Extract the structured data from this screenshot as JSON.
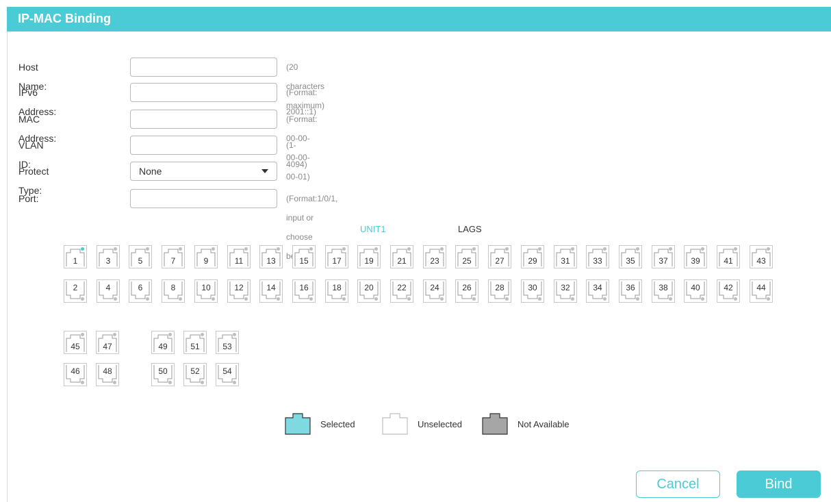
{
  "header": {
    "title": "IP-MAC Binding"
  },
  "form": {
    "host_name": {
      "label": "Host Name:",
      "value": "",
      "hint": "(20 characters maximum)"
    },
    "ipv6": {
      "label": "IPv6 Address:",
      "value": "",
      "hint": "(Format: 2001::1)"
    },
    "mac": {
      "label": "MAC Address:",
      "value": "",
      "hint": "(Format: 00-00-00-00-00-01)"
    },
    "vlan": {
      "label": "VLAN ID:",
      "value": "",
      "hint": "(1-4094)"
    },
    "protect_type": {
      "label": "Protect Type:",
      "selected": "None"
    },
    "port": {
      "label": "Port:",
      "value": "",
      "hint": "(Format:1/0/1, input or choose below)"
    }
  },
  "tabs": {
    "unit1": "UNIT1",
    "lags": "LAGS",
    "active_color": "#4acbd6"
  },
  "ports": {
    "row1": [
      "1",
      "3",
      "5",
      "7",
      "9",
      "11",
      "13",
      "15",
      "17",
      "19",
      "21",
      "23",
      "25",
      "27",
      "29",
      "31",
      "33",
      "35",
      "37",
      "39",
      "41",
      "43"
    ],
    "row2": [
      "2",
      "4",
      "6",
      "8",
      "10",
      "12",
      "14",
      "16",
      "18",
      "20",
      "22",
      "24",
      "26",
      "28",
      "30",
      "32",
      "34",
      "36",
      "38",
      "40",
      "42",
      "44"
    ],
    "group1_top": [
      "45",
      "47"
    ],
    "group1_bottom": [
      "46",
      "48"
    ],
    "group2_top": [
      "49",
      "51",
      "53"
    ],
    "group2_bottom": [
      "50",
      "52",
      "54"
    ],
    "active_port": "1"
  },
  "legend": {
    "selected": "Selected",
    "unselected": "Unselected",
    "not_available": "Not Available"
  },
  "buttons": {
    "cancel": "Cancel",
    "bind": "Bind"
  },
  "colors": {
    "accent": "#4acbd6",
    "not_available": "#a6a6a6"
  }
}
